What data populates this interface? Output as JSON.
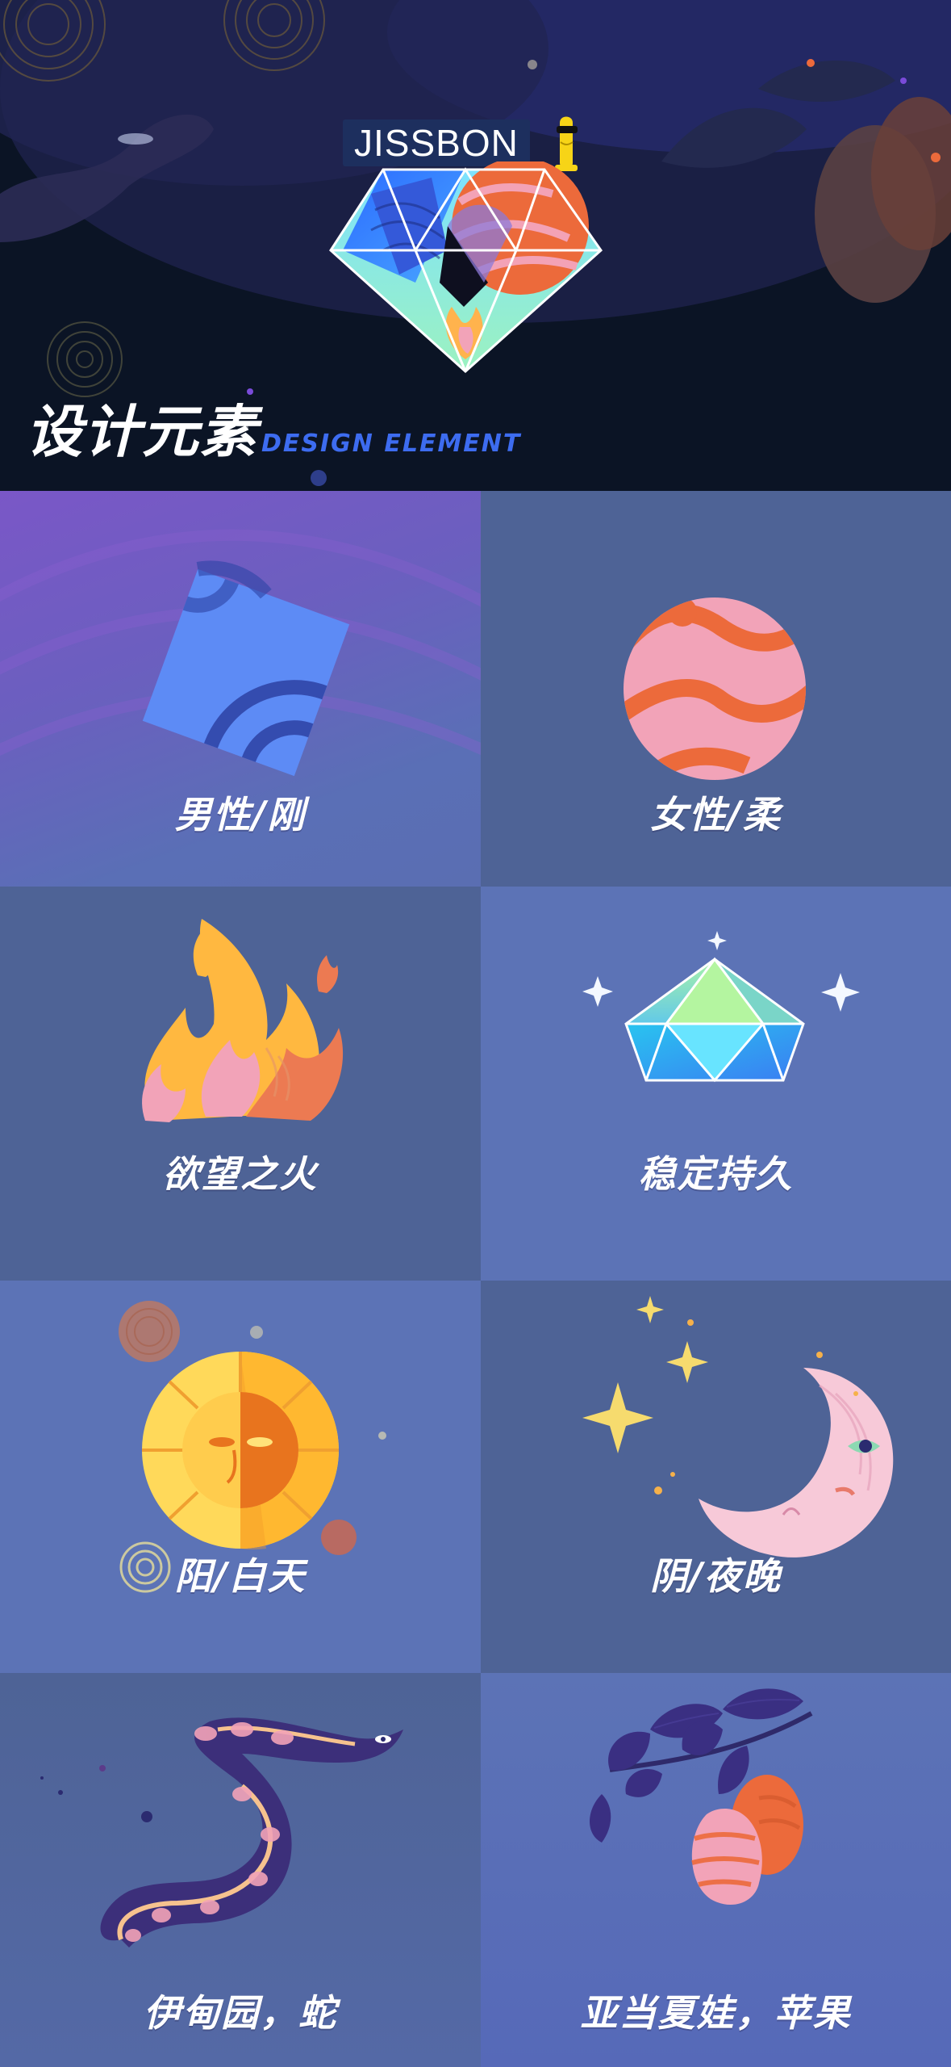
{
  "header": {
    "brand": "JISSBON",
    "section_title": "设计元素",
    "section_subtitle": "DESIGN ELEMENT"
  },
  "elements": [
    {
      "label": "男性/刚",
      "icon": "blue-square-icon"
    },
    {
      "label": "女性/柔",
      "icon": "pink-sphere-icon"
    },
    {
      "label": "欲望之火",
      "icon": "flame-icon"
    },
    {
      "label": "稳定持久",
      "icon": "diamond-icon"
    },
    {
      "label": "阳/白天",
      "icon": "sun-icon"
    },
    {
      "label": "阴/夜晚",
      "icon": "crescent-moon-icon"
    },
    {
      "label": "伊甸园，蛇",
      "icon": "snake-icon"
    },
    {
      "label": "亚当夏娃，苹果",
      "icon": "apple-branch-icon"
    }
  ],
  "colors": {
    "header_bg": "#0b1425",
    "cell_dark": "#4e6396",
    "cell_light": "#5c73b6",
    "accent_blue": "#3d6cf0",
    "coral": "#ec6a3b",
    "pink": "#f2a3b8",
    "yellow": "#ffc63b"
  }
}
